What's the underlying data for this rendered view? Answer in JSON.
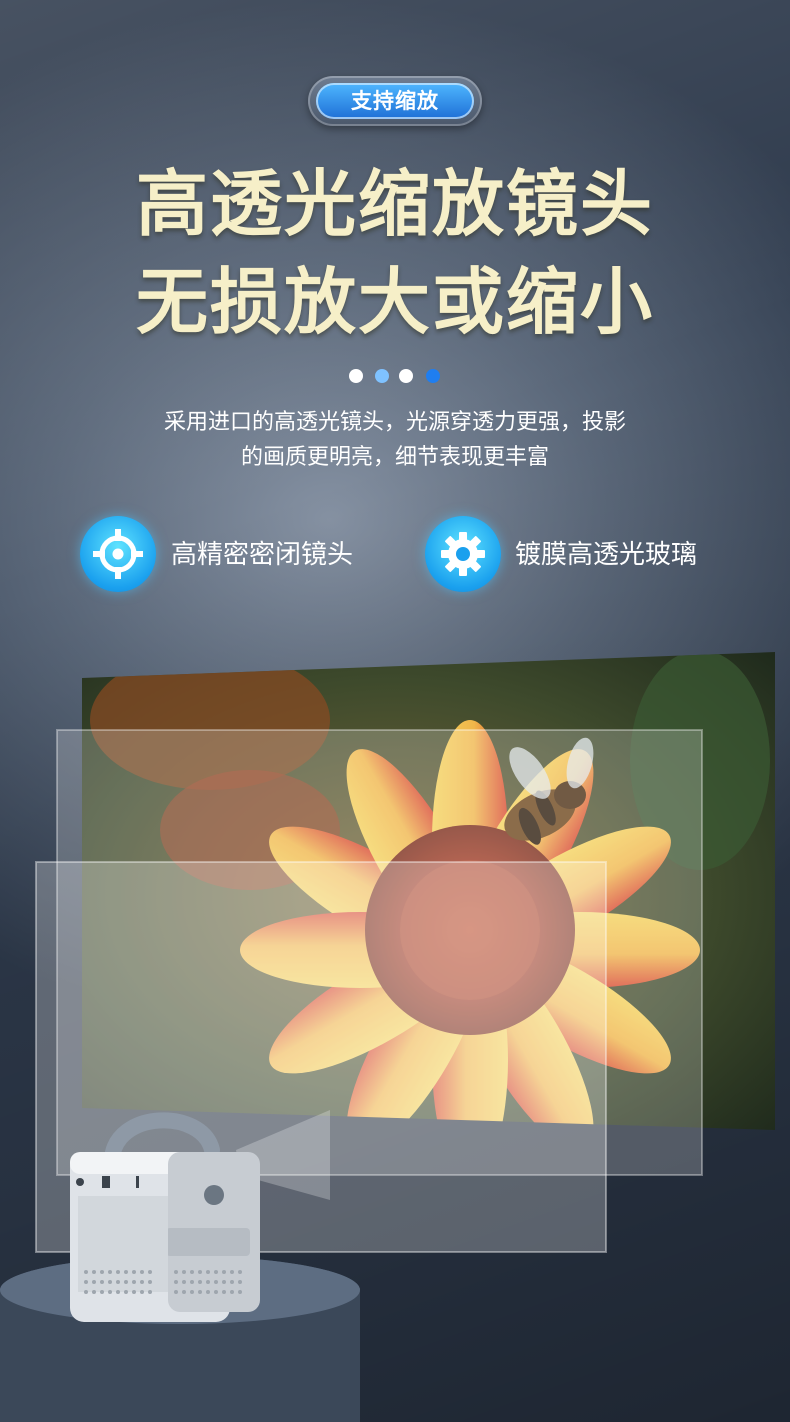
{
  "badge": {
    "label": "支持缩放"
  },
  "headline": {
    "line1": "高透光缩放镜头",
    "line2": "无损放大或缩小"
  },
  "dots": [
    "#ffffff",
    "#7fc2ff",
    "#ffffff",
    "#1f7ef0"
  ],
  "description": {
    "line1": "采用进口的高透光镜头，光源穿透力更强，投影",
    "line2": "的画质更明亮，细节表现更丰富"
  },
  "features": [
    {
      "icon": "crosshair-icon",
      "label": "高精密密闭镜头"
    },
    {
      "icon": "gear-icon",
      "label": "镀膜高透光玻璃"
    }
  ],
  "colors": {
    "title": "#f6efc8",
    "accent": "#1f7ef0",
    "icon_bg": "#1aa0ee"
  }
}
